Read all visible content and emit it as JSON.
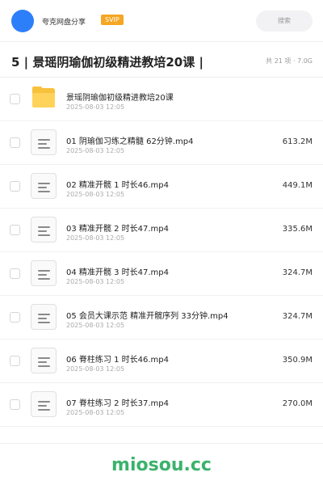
{
  "header": {
    "brand": "夸克网盘分享",
    "badge": "SVIP",
    "search_label": "搜索"
  },
  "folder": {
    "title": "5 | 景瑶阴瑜伽初级精进教培20课 |",
    "meta": "共 21 项 · 7.0G"
  },
  "files": [
    {
      "type": "folder",
      "name": "景瑶阴瑜伽初级精进教培20课",
      "date": "2025-08-03 12:05",
      "size": ""
    },
    {
      "type": "video",
      "name": "01 阴瑜伽习练之精髓 62分钟.mp4",
      "date": "2025-08-03 12:05",
      "size": "613.2M"
    },
    {
      "type": "video",
      "name": "02 精准开髋 1 时长46.mp4",
      "date": "2025-08-03 12:05",
      "size": "449.1M"
    },
    {
      "type": "video",
      "name": "03 精准开髋 2 时长47.mp4",
      "date": "2025-08-03 12:05",
      "size": "335.6M"
    },
    {
      "type": "video",
      "name": "04 精准开髋 3 时长47.mp4",
      "date": "2025-08-03 12:05",
      "size": "324.7M"
    },
    {
      "type": "video",
      "name": "05 会员大课示范 精准开髋序列 33分钟.mp4",
      "date": "2025-08-03 12:05",
      "size": "324.7M"
    },
    {
      "type": "video",
      "name": "06 脊柱练习 1 时长46.mp4",
      "date": "2025-08-03 12:05",
      "size": "350.9M"
    },
    {
      "type": "video",
      "name": "07 脊柱练习 2 时长37.mp4",
      "date": "2025-08-03 12:05",
      "size": "270.0M"
    }
  ],
  "watermark": "miosou.cc",
  "colors": {
    "accent": "#2d7ff9",
    "badge": "#f5a623",
    "folder": "#f8c13c",
    "watermark": "#3bb26b"
  }
}
